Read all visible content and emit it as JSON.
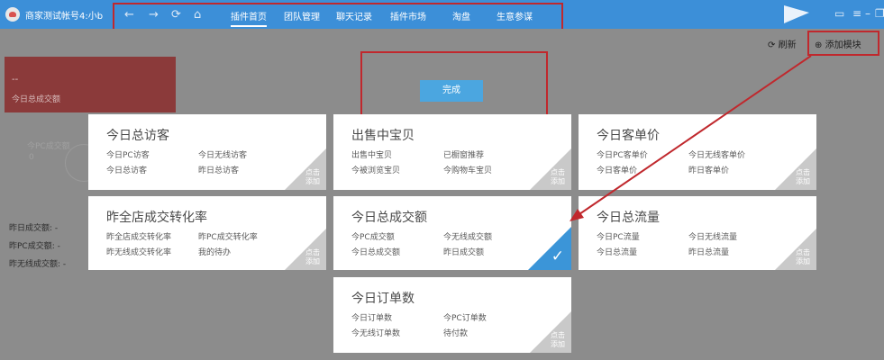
{
  "header": {
    "account": "商家测试帐号4:小b",
    "tabs": [
      {
        "label": "插件首页"
      },
      {
        "label": "团队管理"
      },
      {
        "label": "聊天记录"
      },
      {
        "label": "插件市场"
      },
      {
        "label": "淘盘"
      },
      {
        "label": "生意参谋"
      }
    ]
  },
  "toolbar": {
    "refresh": "刷新",
    "add_block": "添加模块"
  },
  "done_button": "完成",
  "left_panel": {
    "red_title": "--",
    "red_subtitle": "今日总成交额",
    "ghost_label": "今PC成交额",
    "ghost_value": "0",
    "rows": [
      "昨日成交额: -",
      "昨PC成交额: -",
      "昨无线成交额: -"
    ]
  },
  "corner_label": "点击添加",
  "cards": [
    {
      "title": "今日总访客",
      "items": [
        "今日PC访客",
        "今日无线访客",
        "今日总访客",
        "昨日总访客"
      ]
    },
    {
      "title": "出售中宝贝",
      "items": [
        "出售中宝贝",
        "已橱窗推荐",
        "今被浏览宝贝",
        "今购物车宝贝"
      ]
    },
    {
      "title": "今日客单价",
      "items": [
        "今日PC客单价",
        "今日无线客单价",
        "今日客单价",
        "昨日客单价"
      ]
    },
    {
      "title": "昨全店成交转化率",
      "items": [
        "昨全店成交转化率",
        "昨PC成交转化率",
        "昨无线成交转化率",
        "我的待办"
      ]
    },
    {
      "title": "今日总成交额",
      "items": [
        "今PC成交额",
        "今无线成交额",
        "今日总成交额",
        "昨日成交额"
      ]
    },
    {
      "title": "今日总流量",
      "items": [
        "今日PC流量",
        "今日无线流量",
        "今日总流量",
        "昨日总流量"
      ]
    },
    {
      "title": "今日订单数",
      "items": [
        "今日订单数",
        "今PC订单数",
        "今无线订单数",
        "待付款"
      ]
    }
  ],
  "colors": {
    "titlebar": "#3c8fd8",
    "annotation": "#c0282d",
    "selected": "#3b95d8"
  }
}
